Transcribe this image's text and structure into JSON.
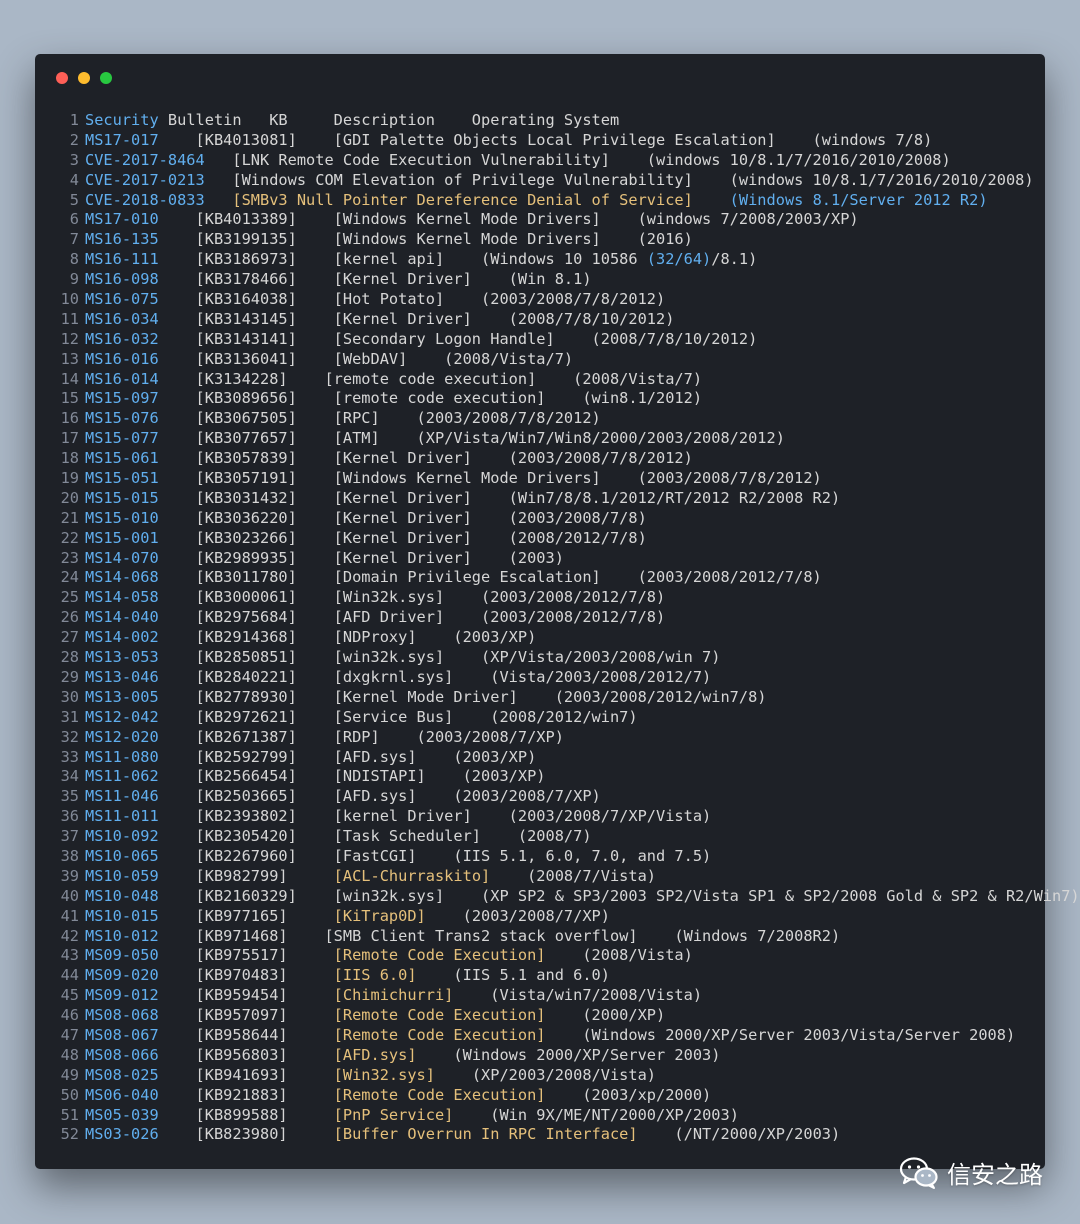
{
  "window": {
    "controls": [
      {
        "name": "close",
        "color": "#fe5f57"
      },
      {
        "name": "minimize",
        "color": "#febc2e"
      },
      {
        "name": "maximize",
        "color": "#28c840"
      }
    ]
  },
  "lines": [
    {
      "n": "1",
      "segs": [
        {
          "t": "Security",
          "c": "blue"
        },
        {
          "t": " Bulletin   KB     Description    Operating System",
          "c": "default"
        }
      ]
    },
    {
      "n": "2",
      "segs": [
        {
          "t": "MS17-017",
          "c": "blue"
        },
        {
          "t": "    [KB4013081]    [GDI Palette Objects Local Privilege Escalation]    (windows 7/8)",
          "c": "default"
        }
      ]
    },
    {
      "n": "3",
      "segs": [
        {
          "t": "CVE-2017-8464",
          "c": "blue"
        },
        {
          "t": "   [LNK Remote Code Execution Vulnerability]    (windows 10/8.1/7/2016/2010/2008)",
          "c": "default"
        }
      ]
    },
    {
      "n": "4",
      "segs": [
        {
          "t": "CVE-2017-0213",
          "c": "blue"
        },
        {
          "t": "   [Windows COM Elevation of Privilege Vulnerability]    (windows 10/8.1/7/2016/2010/2008)",
          "c": "default"
        }
      ]
    },
    {
      "n": "5",
      "segs": [
        {
          "t": "CVE-2018-0833",
          "c": "blue"
        },
        {
          "t": "   [SMBv3 Null Pointer Dereference Denial of Service]",
          "c": "yellow"
        },
        {
          "t": "    (Windows 8.1/Server 2012 R2)",
          "c": "blue"
        }
      ]
    },
    {
      "n": "6",
      "segs": [
        {
          "t": "MS17-010",
          "c": "blue"
        },
        {
          "t": "    [KB4013389]    [Windows Kernel Mode Drivers]    (windows 7/2008/2003/XP)",
          "c": "default"
        }
      ]
    },
    {
      "n": "7",
      "segs": [
        {
          "t": "MS16-135",
          "c": "blue"
        },
        {
          "t": "    [KB3199135]    [Windows Kernel Mode Drivers]    (2016)",
          "c": "default"
        }
      ]
    },
    {
      "n": "8",
      "segs": [
        {
          "t": "MS16-111",
          "c": "blue"
        },
        {
          "t": "    [KB3186973]    [kernel api]    (Windows 10 10586 ",
          "c": "default"
        },
        {
          "t": "(32/64)",
          "c": "blue"
        },
        {
          "t": "/8.1)",
          "c": "default"
        }
      ]
    },
    {
      "n": "9",
      "segs": [
        {
          "t": "MS16-098",
          "c": "blue"
        },
        {
          "t": "    [KB3178466]    [Kernel Driver]    (Win 8.1)",
          "c": "default"
        }
      ]
    },
    {
      "n": "10",
      "segs": [
        {
          "t": "MS16-075",
          "c": "blue"
        },
        {
          "t": "    [KB3164038]    [Hot Potato]    (2003/2008/7/8/2012)",
          "c": "default"
        }
      ]
    },
    {
      "n": "11",
      "segs": [
        {
          "t": "MS16-034",
          "c": "blue"
        },
        {
          "t": "    [KB3143145]    [Kernel Driver]    (2008/7/8/10/2012)",
          "c": "default"
        }
      ]
    },
    {
      "n": "12",
      "segs": [
        {
          "t": "MS16-032",
          "c": "blue"
        },
        {
          "t": "    [KB3143141]    [Secondary Logon Handle]    (2008/7/8/10/2012)",
          "c": "default"
        }
      ]
    },
    {
      "n": "13",
      "segs": [
        {
          "t": "MS16-016",
          "c": "blue"
        },
        {
          "t": "    [KB3136041]    [WebDAV]    (2008/Vista/7)",
          "c": "default"
        }
      ]
    },
    {
      "n": "14",
      "segs": [
        {
          "t": "MS16-014",
          "c": "blue"
        },
        {
          "t": "    [K3134228]    [remote code execution]    (2008/Vista/7)",
          "c": "default"
        }
      ]
    },
    {
      "n": "15",
      "segs": [
        {
          "t": "MS15-097",
          "c": "blue"
        },
        {
          "t": "    [KB3089656]    [remote code execution]    (win8.1/2012)",
          "c": "default"
        }
      ]
    },
    {
      "n": "16",
      "segs": [
        {
          "t": "MS15-076",
          "c": "blue"
        },
        {
          "t": "    [KB3067505]    [RPC]    (2003/2008/7/8/2012)",
          "c": "default"
        }
      ]
    },
    {
      "n": "17",
      "segs": [
        {
          "t": "MS15-077",
          "c": "blue"
        },
        {
          "t": "    [KB3077657]    [ATM]    (XP/Vista/Win7/Win8/2000/2003/2008/2012)",
          "c": "default"
        }
      ]
    },
    {
      "n": "18",
      "segs": [
        {
          "t": "MS15-061",
          "c": "blue"
        },
        {
          "t": "    [KB3057839]    [Kernel Driver]    (2003/2008/7/8/2012)",
          "c": "default"
        }
      ]
    },
    {
      "n": "19",
      "segs": [
        {
          "t": "MS15-051",
          "c": "blue"
        },
        {
          "t": "    [KB3057191]    [Windows Kernel Mode Drivers]    (2003/2008/7/8/2012)",
          "c": "default"
        }
      ]
    },
    {
      "n": "20",
      "segs": [
        {
          "t": "MS15-015",
          "c": "blue"
        },
        {
          "t": "    [KB3031432]    [Kernel Driver]    (Win7/8/8.1/2012/RT/2012 R2/2008 R2)",
          "c": "default"
        }
      ]
    },
    {
      "n": "21",
      "segs": [
        {
          "t": "MS15-010",
          "c": "blue"
        },
        {
          "t": "    [KB3036220]    [Kernel Driver]    (2003/2008/7/8)",
          "c": "default"
        }
      ]
    },
    {
      "n": "22",
      "segs": [
        {
          "t": "MS15-001",
          "c": "blue"
        },
        {
          "t": "    [KB3023266]    [Kernel Driver]    (2008/2012/7/8)",
          "c": "default"
        }
      ]
    },
    {
      "n": "23",
      "segs": [
        {
          "t": "MS14-070",
          "c": "blue"
        },
        {
          "t": "    [KB2989935]    [Kernel Driver]    (2003)",
          "c": "default"
        }
      ]
    },
    {
      "n": "24",
      "segs": [
        {
          "t": "MS14-068",
          "c": "blue"
        },
        {
          "t": "    [KB3011780]    [Domain Privilege Escalation]    (2003/2008/2012/7/8)",
          "c": "default"
        }
      ]
    },
    {
      "n": "25",
      "segs": [
        {
          "t": "MS14-058",
          "c": "blue"
        },
        {
          "t": "    [KB3000061]    [Win32k.sys]    (2003/2008/2012/7/8)",
          "c": "default"
        }
      ]
    },
    {
      "n": "26",
      "segs": [
        {
          "t": "MS14-040",
          "c": "blue"
        },
        {
          "t": "    [KB2975684]    [AFD Driver]    (2003/2008/2012/7/8)",
          "c": "default"
        }
      ]
    },
    {
      "n": "27",
      "segs": [
        {
          "t": "MS14-002",
          "c": "blue"
        },
        {
          "t": "    [KB2914368]    [NDProxy]    (2003/XP)",
          "c": "default"
        }
      ]
    },
    {
      "n": "28",
      "segs": [
        {
          "t": "MS13-053",
          "c": "blue"
        },
        {
          "t": "    [KB2850851]    [win32k.sys]    (XP/Vista/2003/2008/win 7)",
          "c": "default"
        }
      ]
    },
    {
      "n": "29",
      "segs": [
        {
          "t": "MS13-046",
          "c": "blue"
        },
        {
          "t": "    [KB2840221]    [dxgkrnl.sys]    (Vista/2003/2008/2012/7)",
          "c": "default"
        }
      ]
    },
    {
      "n": "30",
      "segs": [
        {
          "t": "MS13-005",
          "c": "blue"
        },
        {
          "t": "    [KB2778930]    [Kernel Mode Driver]    (2003/2008/2012/win7/8)",
          "c": "default"
        }
      ]
    },
    {
      "n": "31",
      "segs": [
        {
          "t": "MS12-042",
          "c": "blue"
        },
        {
          "t": "    [KB2972621]    [Service Bus]    (2008/2012/win7)",
          "c": "default"
        }
      ]
    },
    {
      "n": "32",
      "segs": [
        {
          "t": "MS12-020",
          "c": "blue"
        },
        {
          "t": "    [KB2671387]    [RDP]    (2003/2008/7/XP)",
          "c": "default"
        }
      ]
    },
    {
      "n": "33",
      "segs": [
        {
          "t": "MS11-080",
          "c": "blue"
        },
        {
          "t": "    [KB2592799]    [AFD.sys]    (2003/XP)",
          "c": "default"
        }
      ]
    },
    {
      "n": "34",
      "segs": [
        {
          "t": "MS11-062",
          "c": "blue"
        },
        {
          "t": "    [KB2566454]    [NDISTAPI]    (2003/XP)",
          "c": "default"
        }
      ]
    },
    {
      "n": "35",
      "segs": [
        {
          "t": "MS11-046",
          "c": "blue"
        },
        {
          "t": "    [KB2503665]    [AFD.sys]    (2003/2008/7/XP)",
          "c": "default"
        }
      ]
    },
    {
      "n": "36",
      "segs": [
        {
          "t": "MS11-011",
          "c": "blue"
        },
        {
          "t": "    [KB2393802]    [kernel Driver]    (2003/2008/7/XP/Vista)",
          "c": "default"
        }
      ]
    },
    {
      "n": "37",
      "segs": [
        {
          "t": "MS10-092",
          "c": "blue"
        },
        {
          "t": "    [KB2305420]    [Task Scheduler]    (2008/7)",
          "c": "default"
        }
      ]
    },
    {
      "n": "38",
      "segs": [
        {
          "t": "MS10-065",
          "c": "blue"
        },
        {
          "t": "    [KB2267960]    [FastCGI]    (IIS 5.1, 6.0, 7.0, and 7.5)",
          "c": "default"
        }
      ]
    },
    {
      "n": "39",
      "segs": [
        {
          "t": "MS10-059",
          "c": "blue"
        },
        {
          "t": "    [KB982799]     ",
          "c": "default"
        },
        {
          "t": "[ACL-Churraskito]",
          "c": "yellow"
        },
        {
          "t": "    (2008/7/Vista)",
          "c": "default"
        }
      ]
    },
    {
      "n": "40",
      "segs": [
        {
          "t": "MS10-048",
          "c": "blue"
        },
        {
          "t": "    [KB2160329]    [win32k.sys]    (XP SP2 & SP3/2003 SP2/Vista SP1 & SP2/2008 Gold & SP2 & R2/Win7)",
          "c": "default"
        }
      ]
    },
    {
      "n": "41",
      "segs": [
        {
          "t": "MS10-015",
          "c": "blue"
        },
        {
          "t": "    [KB977165]     ",
          "c": "default"
        },
        {
          "t": "[KiTrap0D]",
          "c": "yellow"
        },
        {
          "t": "    (2003/2008/7/XP)",
          "c": "default"
        }
      ]
    },
    {
      "n": "42",
      "segs": [
        {
          "t": "MS10-012",
          "c": "blue"
        },
        {
          "t": "    [KB971468]    [SMB Client Trans2 stack overflow]    (Windows 7/2008R2)",
          "c": "default"
        }
      ]
    },
    {
      "n": "43",
      "segs": [
        {
          "t": "MS09-050",
          "c": "blue"
        },
        {
          "t": "    [KB975517]     ",
          "c": "default"
        },
        {
          "t": "[Remote Code Execution]",
          "c": "yellow"
        },
        {
          "t": "    (2008/Vista)",
          "c": "default"
        }
      ]
    },
    {
      "n": "44",
      "segs": [
        {
          "t": "MS09-020",
          "c": "blue"
        },
        {
          "t": "    [KB970483]     ",
          "c": "default"
        },
        {
          "t": "[IIS 6.0]",
          "c": "yellow"
        },
        {
          "t": "    (IIS 5.1 and 6.0)",
          "c": "default"
        }
      ]
    },
    {
      "n": "45",
      "segs": [
        {
          "t": "MS09-012",
          "c": "blue"
        },
        {
          "t": "    [KB959454]     ",
          "c": "default"
        },
        {
          "t": "[Chimichurri]",
          "c": "yellow"
        },
        {
          "t": "    (Vista/win7/2008/Vista)",
          "c": "default"
        }
      ]
    },
    {
      "n": "46",
      "segs": [
        {
          "t": "MS08-068",
          "c": "blue"
        },
        {
          "t": "    [KB957097]     ",
          "c": "default"
        },
        {
          "t": "[Remote Code Execution]",
          "c": "yellow"
        },
        {
          "t": "    (2000/XP)",
          "c": "default"
        }
      ]
    },
    {
      "n": "47",
      "segs": [
        {
          "t": "MS08-067",
          "c": "blue"
        },
        {
          "t": "    [KB958644]     ",
          "c": "default"
        },
        {
          "t": "[Remote Code Execution]",
          "c": "yellow"
        },
        {
          "t": "    (Windows 2000/XP/Server 2003/Vista/Server 2008)",
          "c": "default"
        }
      ]
    },
    {
      "n": "48",
      "segs": [
        {
          "t": "MS08-066",
          "c": "blue"
        },
        {
          "t": "    [KB956803]     ",
          "c": "default"
        },
        {
          "t": "[AFD.sys]",
          "c": "yellow"
        },
        {
          "t": "    (Windows 2000/XP/Server 2003)",
          "c": "default"
        }
      ]
    },
    {
      "n": "49",
      "segs": [
        {
          "t": "MS08-025",
          "c": "blue"
        },
        {
          "t": "    [KB941693]     ",
          "c": "default"
        },
        {
          "t": "[Win32.sys]",
          "c": "yellow"
        },
        {
          "t": "    (XP/2003/2008/Vista)",
          "c": "default"
        }
      ]
    },
    {
      "n": "50",
      "segs": [
        {
          "t": "MS06-040",
          "c": "blue"
        },
        {
          "t": "    [KB921883]     ",
          "c": "default"
        },
        {
          "t": "[Remote Code Execution]",
          "c": "yellow"
        },
        {
          "t": "    (2003/xp/2000)",
          "c": "default"
        }
      ]
    },
    {
      "n": "51",
      "segs": [
        {
          "t": "MS05-039",
          "c": "blue"
        },
        {
          "t": "    [KB899588]     ",
          "c": "default"
        },
        {
          "t": "[PnP Service]",
          "c": "yellow"
        },
        {
          "t": "    (Win 9X/ME/NT/2000/XP/2003)",
          "c": "default"
        }
      ]
    },
    {
      "n": "52",
      "segs": [
        {
          "t": "MS03-026",
          "c": "blue"
        },
        {
          "t": "    [KB823980]     ",
          "c": "default"
        },
        {
          "t": "[Buffer Overrun In RPC Interface]",
          "c": "yellow"
        },
        {
          "t": "    (/NT/2000/XP/2003)",
          "c": "default"
        }
      ]
    }
  ],
  "watermark": {
    "icon": "wechat-icon",
    "text": "信安之路"
  },
  "colors": {
    "blue": "#61afef",
    "yellow": "#e5c07b",
    "default": "#d6d6d6",
    "line_number": "#828997",
    "background": "#1e2127"
  }
}
